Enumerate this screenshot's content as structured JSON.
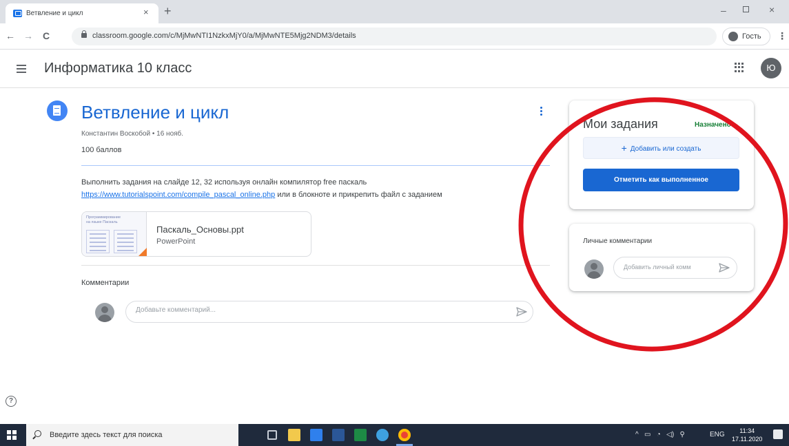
{
  "browser": {
    "tab_title": "Ветвление и цикл",
    "tab_close": "×",
    "new_tab": "+",
    "url": "classroom.google.com/c/MjMwNTI1NzkxMjY0/a/MjMwNTE5Mjg2NDM3/details",
    "guest_label": "Гость",
    "nav_back": "←",
    "nav_forward": "→",
    "nav_reload": "C",
    "win_minimize": "–",
    "win_close": "×",
    "menu": "⋮"
  },
  "header": {
    "class_title": "Информатика 10 класс",
    "avatar_letter": "Ю"
  },
  "assignment": {
    "title": "Ветвление и цикл",
    "meta": "Константин Воскобой • 16 нояб.",
    "points": "100 баллов",
    "description_line1": "Выполнить задания на слайде 12, 32 используя онлайн компилятор  free паскаль",
    "description_link": "https://www.tutorialspoint.com/compile_pascal_online.php",
    "description_line2_tail": " или в блокноте и прикрепить файл с заданием",
    "attachment": {
      "thumbnail_text": "Программирование\nна языке Паскаль",
      "name": "Паскаль_Основы.ppt",
      "type": "PowerPoint"
    },
    "comments_heading": "Комментарии",
    "comment_placeholder": "Добавьте комментарий..."
  },
  "my_work": {
    "title": "Мои задания",
    "status": "Назначено",
    "add_label": "Добавить или создать",
    "add_plus": "+",
    "mark_done_label": "Отметить как выполненное"
  },
  "private_comments": {
    "title": "Личные комментарии",
    "placeholder": "Добавить личный комм"
  },
  "help": "?",
  "taskbar": {
    "search_text": "Введите здесь текст для поиска",
    "tray_lang": "ENG",
    "time": "11:34",
    "date": "17.11.2020"
  },
  "colors": {
    "primary_blue": "#1967d2",
    "status_green": "#188038",
    "annotation_red": "#e0141e",
    "taskbar": "#1f2a3c"
  }
}
